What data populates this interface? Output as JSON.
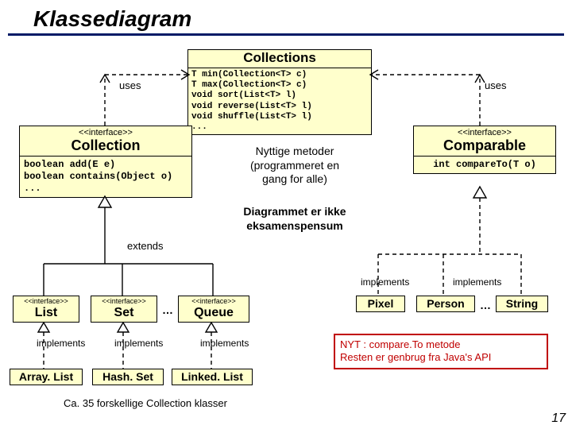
{
  "title": "Klassediagram",
  "collectionsHeader": "Collections",
  "collectionsMethods": "T min(Collection<T> c)\nT max(Collection<T> c)\nvoid sort(List<T> l)\nvoid reverse(List<T> l)\nvoid shuffle(List<T> l)\n...",
  "labels": {
    "usesLeft": "uses",
    "usesRight": "uses",
    "extends": "extends",
    "impl1": "implements",
    "impl2": "implements",
    "impl3": "implements",
    "implPixel": "implements",
    "implPerson": "implements"
  },
  "collection": {
    "stereo": "<<interface>>",
    "name": "Collection",
    "members": "boolean add(E e)\nboolean contains(Object o)\n..."
  },
  "comparable": {
    "stereo": "<<interface>>",
    "name": "Comparable",
    "members": "int compareTo(T o)"
  },
  "list": {
    "stereo": "<<interface>>",
    "name": "List"
  },
  "set": {
    "stereo": "<<interface>>",
    "name": "Set"
  },
  "queue": {
    "stereo": "<<interface>>",
    "name": "Queue"
  },
  "arraylist": {
    "name": "Array. List"
  },
  "hashset": {
    "name": "Hash. Set"
  },
  "linkedlist": {
    "name": "Linked. List"
  },
  "pixel": {
    "name": "Pixel"
  },
  "person": {
    "name": "Person"
  },
  "string": {
    "name": "String"
  },
  "note1": "Nyttige metoder\n(programmeret en\ngang for alle)",
  "note2": "Diagrammet er ikke\neksamenspensum",
  "redbox": "NYT : compare.To metode\nResten er genbrug fra Java's API",
  "footer": "Ca. 35 forskellige Collection klasser",
  "ell1": "…",
  "ell2": "…",
  "pagenum": "17"
}
